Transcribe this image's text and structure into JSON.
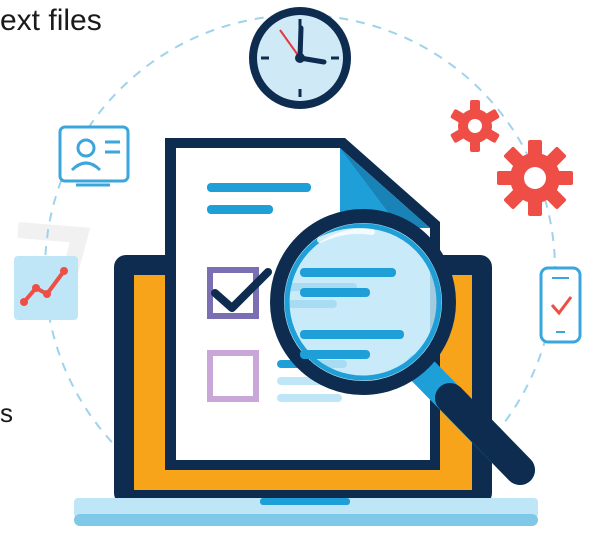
{
  "texts": {
    "top": "ext files",
    "side": "s"
  },
  "icons": [
    "wall-clock-icon",
    "id-card-icon",
    "line-chart-icon",
    "gears-icon",
    "smartphone-check-icon",
    "laptop-icon",
    "document-icon",
    "checked-checkbox-icon",
    "empty-checkbox-icon",
    "magnifying-glass-icon"
  ],
  "colors": {
    "navy": "#0d2c4f",
    "blue": "#1e9fd8",
    "orange": "#f7a41b",
    "red_gear": "#ee4e46",
    "purple": "#7b6fb4",
    "light_blue": "#bfe6f7",
    "clock_face": "#cfe9f7"
  }
}
